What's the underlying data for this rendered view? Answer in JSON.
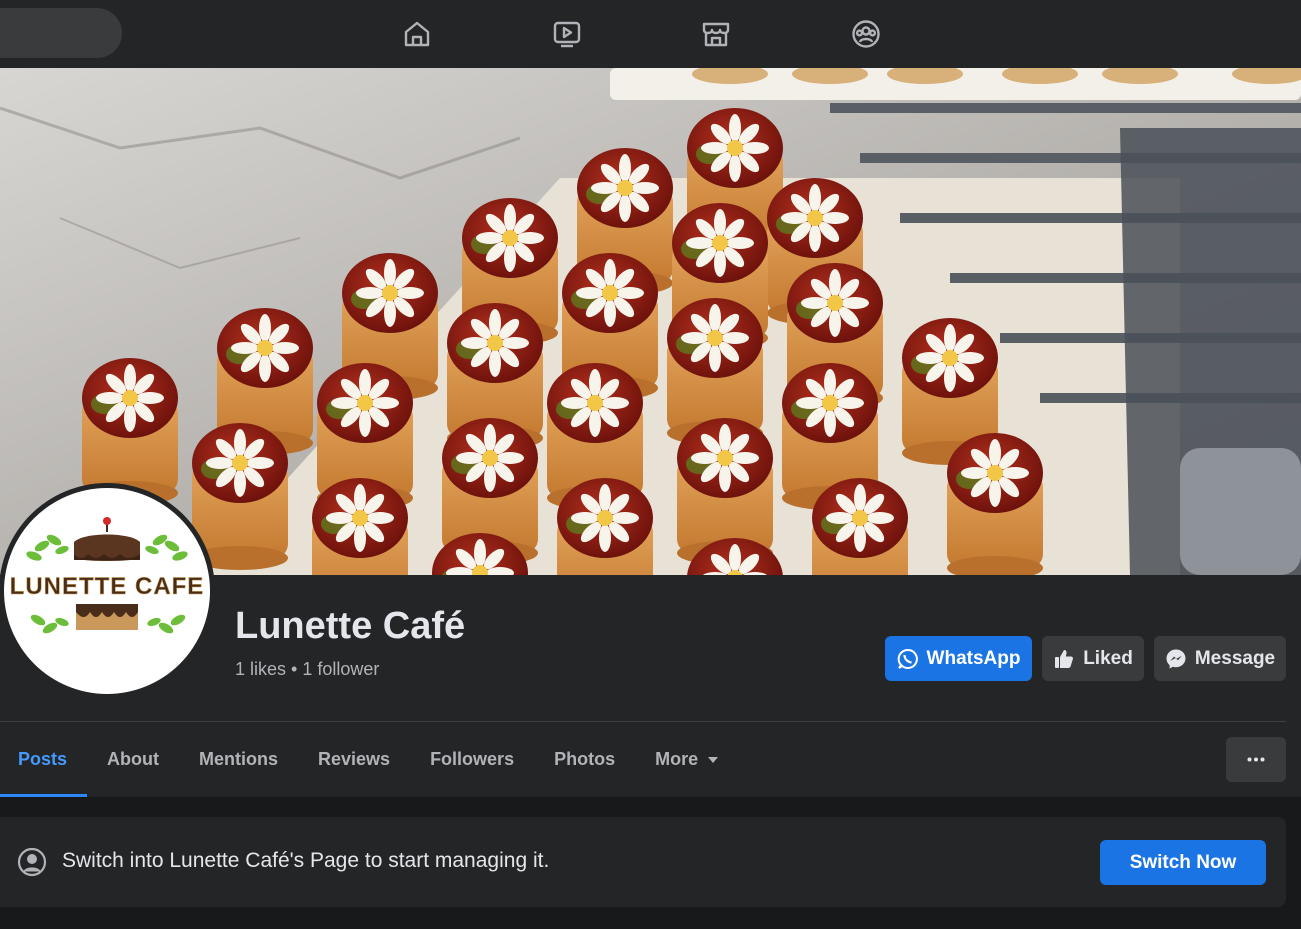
{
  "topnav": {
    "icons": [
      "home-icon",
      "video-icon",
      "marketplace-icon",
      "groups-icon"
    ]
  },
  "page": {
    "name": "Lunette Café",
    "stats": "1 likes • 1 follower",
    "logo_text": "LUNETTE CAFE"
  },
  "actions": {
    "whatsapp": "WhatsApp",
    "liked": "Liked",
    "message": "Message"
  },
  "tabs": [
    {
      "label": "Posts"
    },
    {
      "label": "About"
    },
    {
      "label": "Mentions"
    },
    {
      "label": "Reviews"
    },
    {
      "label": "Followers"
    },
    {
      "label": "Photos"
    },
    {
      "label": "More"
    }
  ],
  "switch_banner": {
    "text": "Switch into Lunette Café's Page to start managing it.",
    "button": "Switch Now"
  },
  "colors": {
    "accent": "#1b74e4",
    "active_tab": "#4599ff",
    "background": "#18191a",
    "surface": "#242526"
  }
}
